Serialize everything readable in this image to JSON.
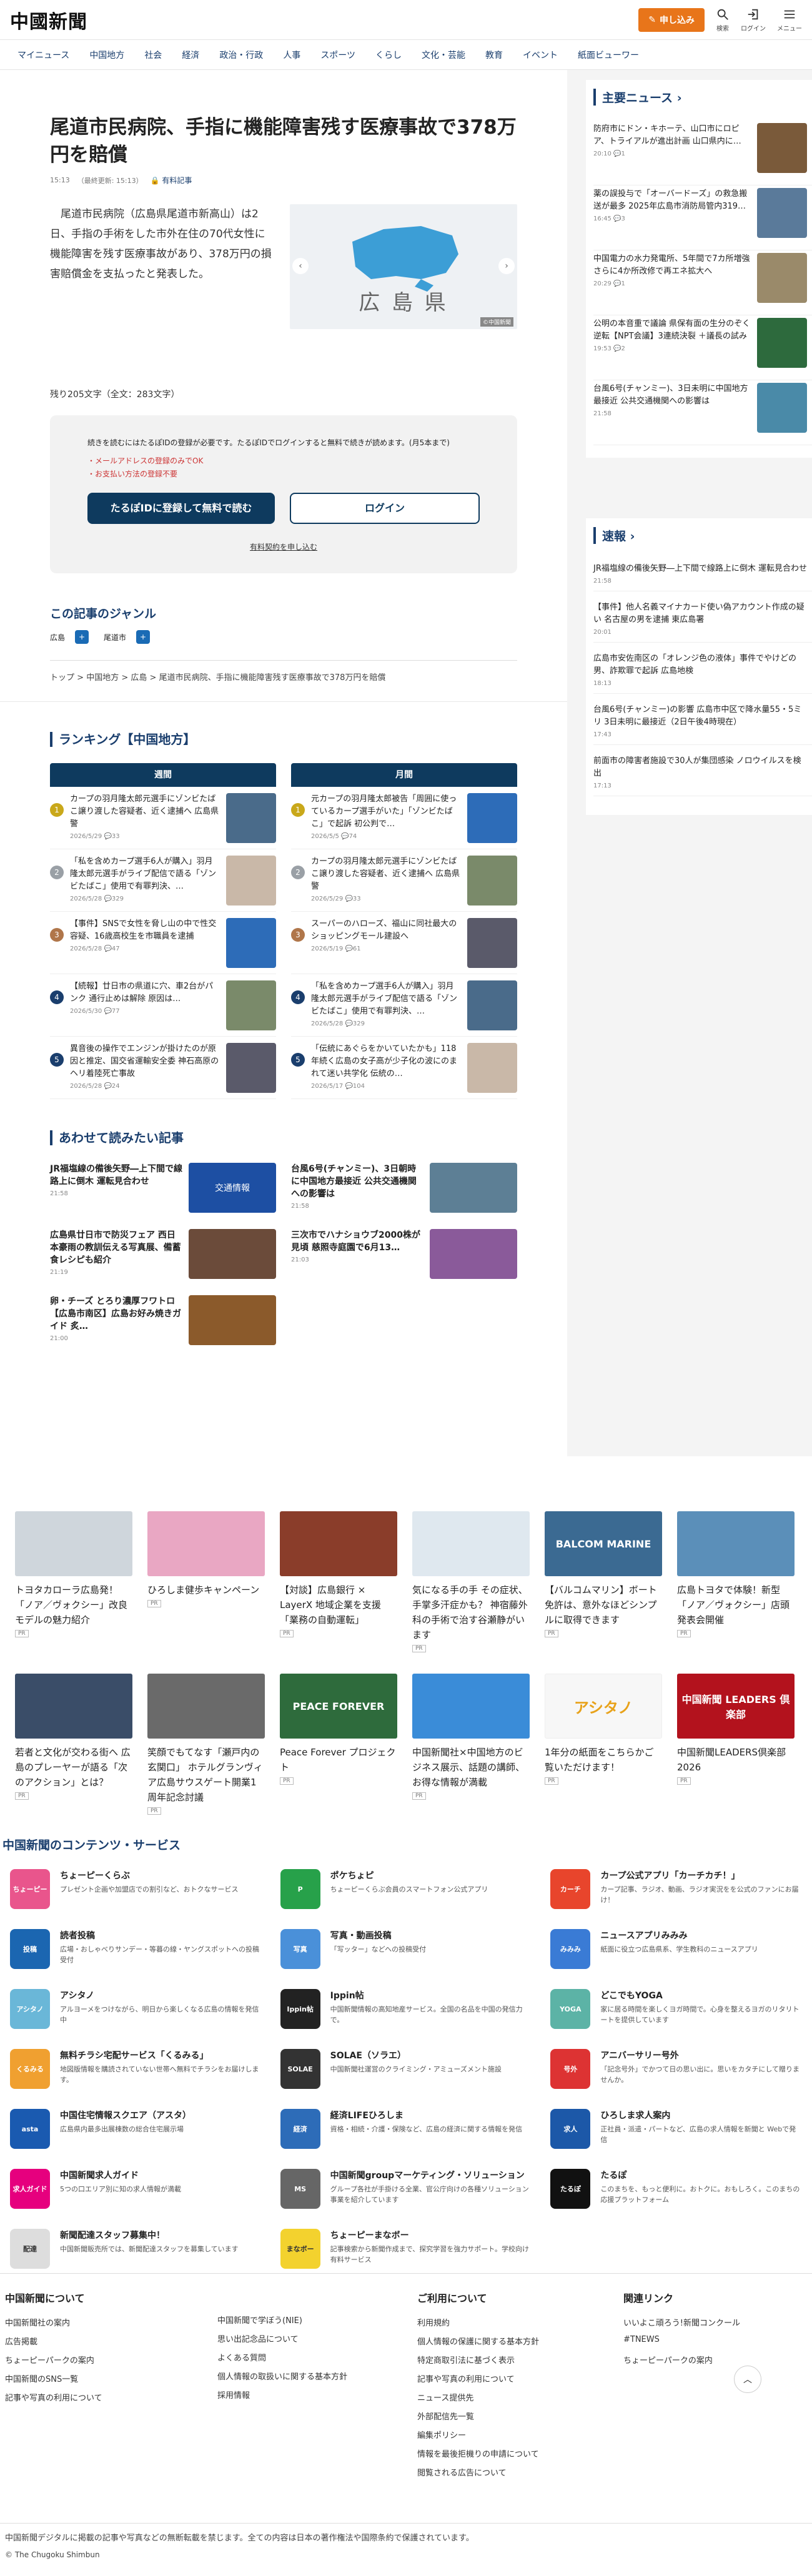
{
  "header": {
    "logo": "中國新聞",
    "subscribe": "申し込み",
    "search": "検索",
    "login": "ログイン",
    "menu": "メニュー"
  },
  "nav": [
    "マイニュース",
    "中国地方",
    "社会",
    "経済",
    "政治・行政",
    "人事",
    "スポーツ",
    "くらし",
    "文化・芸能",
    "教育",
    "イベント",
    "紙面ビューワー"
  ],
  "article": {
    "title": "尾道市民病院、手指に機能障害残す医療事故で378万円を賠償",
    "time": "15:13",
    "updated": "（最終更新: 15:13）",
    "badge": "有料記事",
    "lead": "尾道市民病院（広島県尾道市新高山）は2日、手指の手術をした市外在住の70代女性に機能障害を残す医療事故があり、378万円の損害賠償金を支払ったと発表した。",
    "map_label": "広 島 県",
    "map_credit": "©中国新聞",
    "remaining": "残り205文字（全文：283文字）"
  },
  "paywall": {
    "text": "続きを読むにはたるぽIDの登録が必要です。たるぽIDでログインすると無料で続きが読めます。(月5本まで)",
    "note1": "・メールアドレスの登録のみでOK",
    "note2": "・お支払い方法の登録不要",
    "register": "たるぽIDに登録して無料で読む",
    "login": "ログイン",
    "paid": "有料契約を申し込む"
  },
  "genre": {
    "heading": "この記事のジャンル",
    "tags": [
      "広島",
      "尾道市"
    ]
  },
  "breadcrumb": [
    "トップ",
    "中国地方",
    "広島",
    "尾道市民病院、手指に機能障害残す医療事故で378万円を賠償"
  ],
  "ranking": {
    "heading": "ランキング【中国地方】",
    "weekly": "週間",
    "monthly": "月間",
    "week_items": [
      {
        "n": "1",
        "t": "カープの羽月隆太郎元選手にゾンビたばこ譲り渡した容疑者、近く逮捕へ 広島県警",
        "d": "2026/5/29",
        "c": "33"
      },
      {
        "n": "2",
        "t": "「私を含めカープ選手6人が購入」羽月隆太郎元選手がライブ配信で語る「ゾンビたばこ」使用で有罪判決、…",
        "d": "2026/5/28",
        "c": "329"
      },
      {
        "n": "3",
        "t": "【事件】SNSで女性を脅し山の中で性交容疑、16歳高校生を市職員を逮捕",
        "d": "2026/5/28",
        "c": "47"
      },
      {
        "n": "4",
        "t": "【続報】廿日市の県道に穴、車2台がパンク 通行止めは解除 原因は…",
        "d": "2026/5/30",
        "c": "77"
      },
      {
        "n": "5",
        "t": "異音後の操作でエンジンが掛けたのが原因と推定、国交省運輸安全委 神石高原のヘリ着陸死亡事故",
        "d": "2026/5/28",
        "c": "24"
      }
    ],
    "month_items": [
      {
        "n": "1",
        "t": "元カープの羽月隆太郎被告「周囲に使っているカープ選手がいた」「ゾンビたばこ」で起訴 初公判で…",
        "d": "2026/5/5",
        "c": "74"
      },
      {
        "n": "2",
        "t": "カープの羽月隆太郎元選手にゾンビたばこ譲り渡した容疑者、近く逮捕へ 広島県警",
        "d": "2026/5/29",
        "c": "33"
      },
      {
        "n": "3",
        "t": "スーパーのハローズ、福山に同社最大のショッピングモール建設へ",
        "d": "2026/5/19",
        "c": "61"
      },
      {
        "n": "4",
        "t": "「私を含めカープ選手6人が購入」羽月隆太郎元選手がライブ配信で語る「ゾンビたばこ」使用で有罪判決、…",
        "d": "2026/5/28",
        "c": "329"
      },
      {
        "n": "5",
        "t": "「伝統にあぐらをかいていたかも」118年続く広島の女子高が少子化の波にのまれて迷い共学化 伝統の…",
        "d": "2026/5/17",
        "c": "104"
      }
    ]
  },
  "related": {
    "heading": "あわせて読みたい記事",
    "items": [
      {
        "t": "JR福塩線の備後矢野―上下間で線路上に倒木 運転見合わせ",
        "d": "21:58",
        "img": "交通情報"
      },
      {
        "t": "台風6号(チャンミー)、3日朝時に中国地方最接近 公共交通機関への影響は",
        "d": "21:58"
      },
      {
        "t": "広島県廿日市で防災フェア 西日本豪雨の教訓伝える写真展、備蓄食レシピも紹介",
        "d": "21:19"
      },
      {
        "t": "三次市でハナショウブ2000株が見頃 慈照寺庭園で6月13…",
        "d": "21:03"
      },
      {
        "t": "卵・チーズ とろり濃厚フワトロ【広島市南区】広島お好み焼きガイド 炙…",
        "d": "21:00"
      }
    ]
  },
  "sidebar": {
    "heading": "主要ニュース",
    "items": [
      {
        "t": "防府市にドン・キホーテ、山口市にロピア、トライアルが進出計画 山口県内に…",
        "d": "20:10",
        "c": "1"
      },
      {
        "t": "薬の誤投与で「オーバードーズ」の救急搬送が最多 2025年広島市消防局管内319…",
        "d": "16:45",
        "c": "3"
      },
      {
        "t": "中国電力の水力発電所、5年間で7カ所増強 さらに4か所改修で再エネ拡大へ",
        "d": "20:29",
        "c": "1"
      },
      {
        "t": "公明の本音重で議論 県保有面の生分のぞく 逆転【NPT会議】3連続決裂 ＋議長の試み",
        "d": "19:53",
        "c": "2"
      },
      {
        "t": "台風6号(チャンミー)、3日未明に中国地方最接近 公共交通機関への影響は",
        "d": "21:58"
      }
    ]
  },
  "sokuho": {
    "heading": "速報",
    "items": [
      {
        "t": "JR福塩線の備後矢野―上下間で線路上に倒木 運転見合わせ",
        "d": "21:58"
      },
      {
        "t": "【事件】他人名義マイナカード使い偽アカウント作成の疑い 名古屋の男を逮捕 東広島署",
        "d": "20:01"
      },
      {
        "t": "広島市安佐南区の「オレンジ色の液体」事件でやけどの男、詐欺罪で起訴 広島地検",
        "d": "18:13"
      },
      {
        "t": "台風6号(チャンミー)の影響 広島市中区で降水量55・5ミリ 3日未明に最接近（2日午後4時現在）",
        "d": "17:43"
      },
      {
        "t": "前面市の障害者施設で30人が集団感染 ノロウイルスを検出",
        "d": "17:13"
      }
    ]
  },
  "promos": [
    {
      "t": "トヨタカローラ広島発！「ノア／ヴォクシー」改良モデルの魅力紹介"
    },
    {
      "t": "ひろしま健歩キャンペーン"
    },
    {
      "t": "【対談】広島銀行 × LayerX 地域企業を支援「業務の自動運転」"
    },
    {
      "t": "気になる手の手 その症状、手掌多汗症かも？ 神宿藤外科の手術で治す谷瀬静がいます"
    },
    {
      "t": "【バルコムマリン】ボート免許は、意外なほどシンプルに取得できます"
    },
    {
      "t": "広島トヨタで体験！新型「ノア／ヴォクシー」店頭発表会開催"
    },
    {
      "t": "若者と文化が交わる街へ 広島のプレーヤーが語る「次のアクション」とは？"
    },
    {
      "t": "笑顔でもてなす「瀬戸内の玄関口」 ホテルグランヴィア広島サウスゲート開業1周年記念討議"
    },
    {
      "t": "Peace Forever プロジェクト"
    },
    {
      "t": "中国新聞社×中国地方のビジネス展示、話題の講師、お得な情報が満載"
    },
    {
      "t": "1年分の紙面をこちらかご覧いただけます！"
    },
    {
      "t": "中国新聞LEADERS倶楽部2026"
    }
  ],
  "promo_pr": "PR",
  "promo_img": {
    "peace": "PEACE FOREVER",
    "asutano": "アシタノ",
    "leaders": "中国新聞 LEADERS 倶楽部",
    "marine": "BALCOM MARINE"
  },
  "services": {
    "heading": "中国新聞のコンテンツ・サービス",
    "items": [
      {
        "n": "ちょーピーくらぶ",
        "d": "プレゼント企画や加盟店での割引など、おトクなサービス",
        "l": "ちょーピー",
        "col": "#e9558c"
      },
      {
        "n": "ポケちょピ",
        "d": "ちょーピーくらぶ会員のスマートフォン公式アプリ",
        "l": "P",
        "col": "#27a14a"
      },
      {
        "n": "カープ公式アプリ「カーチカチ！」",
        "d": "カープ記事、ラジオ、動画、ラジオ実況をを公式のファンにお届け！",
        "l": "カーチ",
        "col": "#e8452c"
      },
      {
        "n": "読者投稿",
        "d": "広場・おしゃべりサンデー・等暮の線・ヤングスポットへの投稿受付",
        "l": "投稿",
        "col": "#1b66b1"
      },
      {
        "n": "写真・動画投稿",
        "d": "「写ッター」などへの投稿受付",
        "l": "写真",
        "col": "#4a90d9"
      },
      {
        "n": "ニュースアプリみみみ",
        "d": "紙面に役立つ広島県系、学生教科のニュースアプリ",
        "l": "みみみ",
        "col": "#3a7bd5"
      },
      {
        "n": "アシタノ",
        "d": "アルヨーメをつけながら、明日から楽しくなる広島の情報を発信中",
        "l": "アシタノ",
        "col": "#6ab7d8"
      },
      {
        "n": "Ippin帖",
        "d": "中国新聞情報の高知地産サービス。全国の名品を中国の発信力で。",
        "l": "Ippin帖",
        "col": "#222"
      },
      {
        "n": "どこでもYOGA",
        "d": "家に居る時間を楽しくヨガ時間で。心身を整えるヨガのリタリトートを提供しています",
        "l": "YOGA",
        "col": "#5cb3a6"
      },
      {
        "n": "無料チラシ宅配サービス「くるみる」",
        "d": "地図版情報を購読されていない世帯へ無料でチラシをお届けします。",
        "l": "くるみる",
        "col": "#f0a030"
      },
      {
        "n": "SOLAE（ソラエ）",
        "d": "中国新聞社運営のクライミング・アミューズメント施設",
        "l": "SOLAE",
        "col": "#333"
      },
      {
        "n": "アニバーサリー号外",
        "d": "「記念号外」でかつて日の思い出に。思いをカタチにして贈りませんか。",
        "l": "号外",
        "col": "#d33"
      },
      {
        "n": "中国住宅情報スクエア（アスタ）",
        "d": "広島県内最多出展棟数の総合住宅展示場",
        "l": "asta",
        "col": "#1a5ab0"
      },
      {
        "n": "経済LIFEひろしま",
        "d": "資格・相続・介護・保険など、広島の経済に関する情報を発信",
        "l": "経済",
        "col": "#2d6cb8"
      },
      {
        "n": "ひろしま求人案内",
        "d": "正社員・派遣・パートなど、広島の求人情報を新聞と Webで発信",
        "l": "求人",
        "col": "#1c58a8"
      },
      {
        "n": "中国新聞求人ガイド",
        "d": "5つの口エリア別に知の求人情報が満載",
        "l": "求人ガイド",
        "col": "#e6007e"
      },
      {
        "n": "中国新聞groupマーケティング・ソリューション",
        "d": "グループ各社が手掛ける全業、官公庁向けの各種ソリューション事業を紹介しています",
        "l": "MS",
        "col": "#666"
      },
      {
        "n": "たるぽ",
        "d": "このまちを、もっと便利に。おトクに。おもしろく。このまちの応援プラットフォーム",
        "l": "たるぽ",
        "col": "#111"
      },
      {
        "n": "新聞配達スタッフ募集中！",
        "d": "中国新聞販売所では、新聞配達スタッフを募集しています",
        "l": "配達",
        "col": "#ddd"
      },
      {
        "n": "ちょーピーまなボー",
        "d": "記事検索から新聞作成まで、探究学習を強力サポート。学校向け有料サービス",
        "l": "まなボー",
        "col": "#f3d22e"
      }
    ]
  },
  "footer": {
    "col1": {
      "h": "中国新聞について",
      "items": [
        "中国新聞社の案内",
        "広告掲載",
        "ちょーピーパークの案内",
        "中国新聞のSNS一覧",
        "記事や写真の利用について"
      ]
    },
    "col2": {
      "items": [
        "中国新聞で学ぼう(NIE)",
        "思い出記念品について",
        "よくある質問",
        "個人情報の取扱いに関する基本方針",
        "採用情報"
      ]
    },
    "col3": {
      "h": "ご利用について",
      "items": [
        "利用規約",
        "個人情報の保護に関する基本方針",
        "特定商取引法に基づく表示",
        "記事や写真の利用について",
        "ニュース提供先",
        "外部配信先一覧",
        "編集ポリシー",
        "情報を最後拒機りの申請について",
        "閲覧される広告について"
      ]
    },
    "col4": {
      "h": "関連リンク",
      "items": [
        "いいよこ頑ろう!新聞コンクール",
        "#TNEWS",
        "ちょーピーパークの案内"
      ]
    },
    "copy1": "中国新聞デジタルに掲載の記事や写真などの無断転載を禁じます。全ての内容は日本の著作権法や国際条約で保護されています。",
    "copy2": "© The Chugoku Shimbun"
  }
}
